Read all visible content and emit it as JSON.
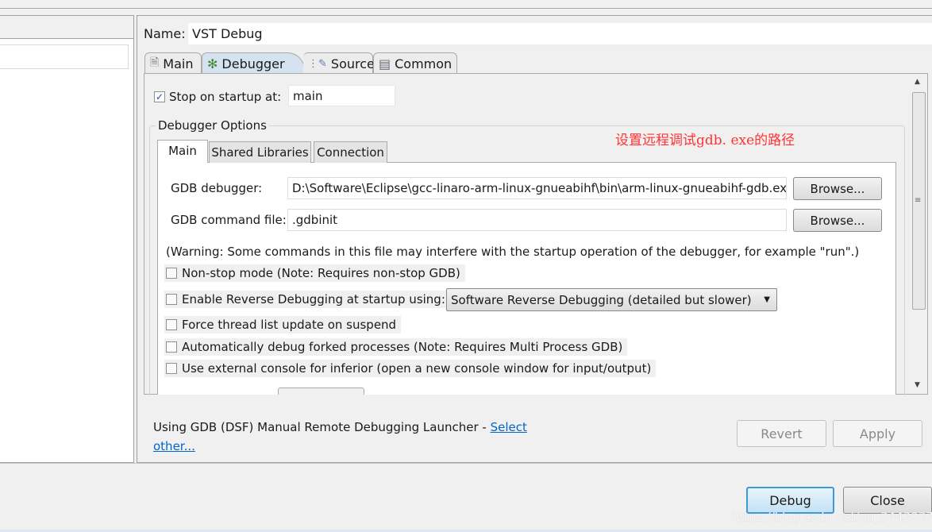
{
  "name_label": "Name:",
  "name_value": "VST Debug",
  "tabs": [
    {
      "label": "Main",
      "icon": "document-icon"
    },
    {
      "label": "Debugger",
      "icon": "bug-icon"
    },
    {
      "label": "Source",
      "icon": "source-icon"
    },
    {
      "label": "Common",
      "icon": "table-icon"
    }
  ],
  "stop_on_startup": {
    "label": "Stop on startup at:",
    "checked": true,
    "value": "main"
  },
  "debugger_options": {
    "title": "Debugger Options",
    "tabs": [
      "Main",
      "Shared Libraries",
      "Connection"
    ],
    "gdb_debugger": {
      "label": "GDB debugger:",
      "value": "D:\\Software\\Eclipse\\gcc-linaro-arm-linux-gnueabihf\\bin\\arm-linux-gnueabihf-gdb.exe",
      "browse": "Browse..."
    },
    "gdb_command_file": {
      "label": "GDB command file:",
      "value": ".gdbinit",
      "browse": "Browse..."
    },
    "warning": "(Warning: Some commands in this file may interfere with the startup operation of the debugger, for example \"run\".)",
    "options": [
      {
        "label": "Non-stop mode (Note: Requires non-stop GDB)",
        "checked": false
      },
      {
        "label": "Enable Reverse Debugging at startup using:",
        "checked": false
      },
      {
        "label": "Force thread list update on suspend",
        "checked": false
      },
      {
        "label": "Automatically debug forked processes (Note: Requires Multi Process GDB)",
        "checked": false
      },
      {
        "label": "Use external console for inferior (open a new console window for input/output)",
        "checked": false
      }
    ],
    "reverse_select": "Software Reverse Debugging (detailed but slower)"
  },
  "annotation": {
    "text": "设置远程调试gdb. exe的路径",
    "color": "#ff3333"
  },
  "launcher": {
    "text": "Using GDB (DSF) Manual Remote Debugging Launcher - ",
    "link1": "Select",
    "link2": "other..."
  },
  "buttons": {
    "revert": "Revert",
    "apply": "Apply",
    "debug": "Debug",
    "close": "Close"
  },
  "watermark": "https://blog.csdn.net/qq_34430371"
}
